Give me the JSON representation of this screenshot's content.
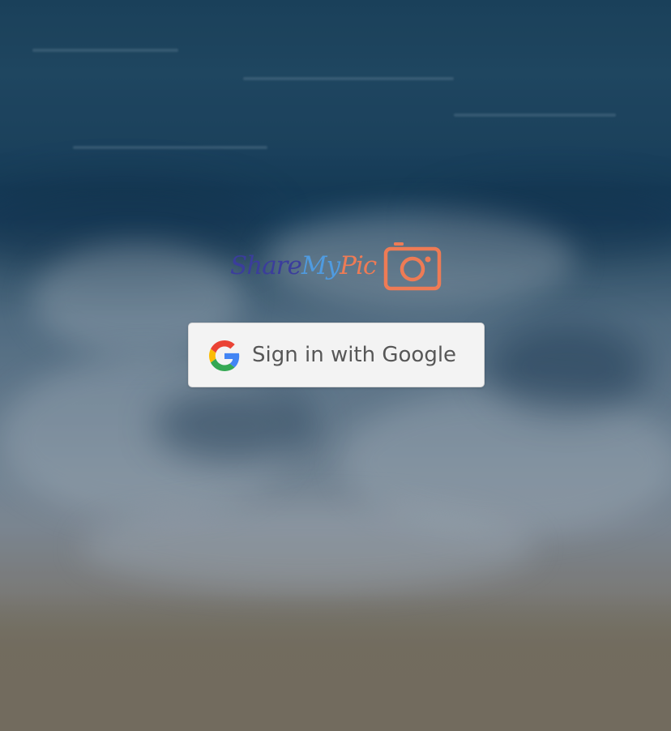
{
  "app": {
    "logo": {
      "word_share": "Share",
      "word_my": "My",
      "word_pic": "Pic",
      "icon": "camera-icon"
    }
  },
  "auth": {
    "google_button_label": "Sign in with Google",
    "google_button_icon": "google-g-icon"
  },
  "colors": {
    "logo_share": "#3b3d9c",
    "logo_my": "#4f9be0",
    "logo_pic": "#ee7b55",
    "button_background": "#f3f3f3",
    "button_text": "#575757"
  }
}
